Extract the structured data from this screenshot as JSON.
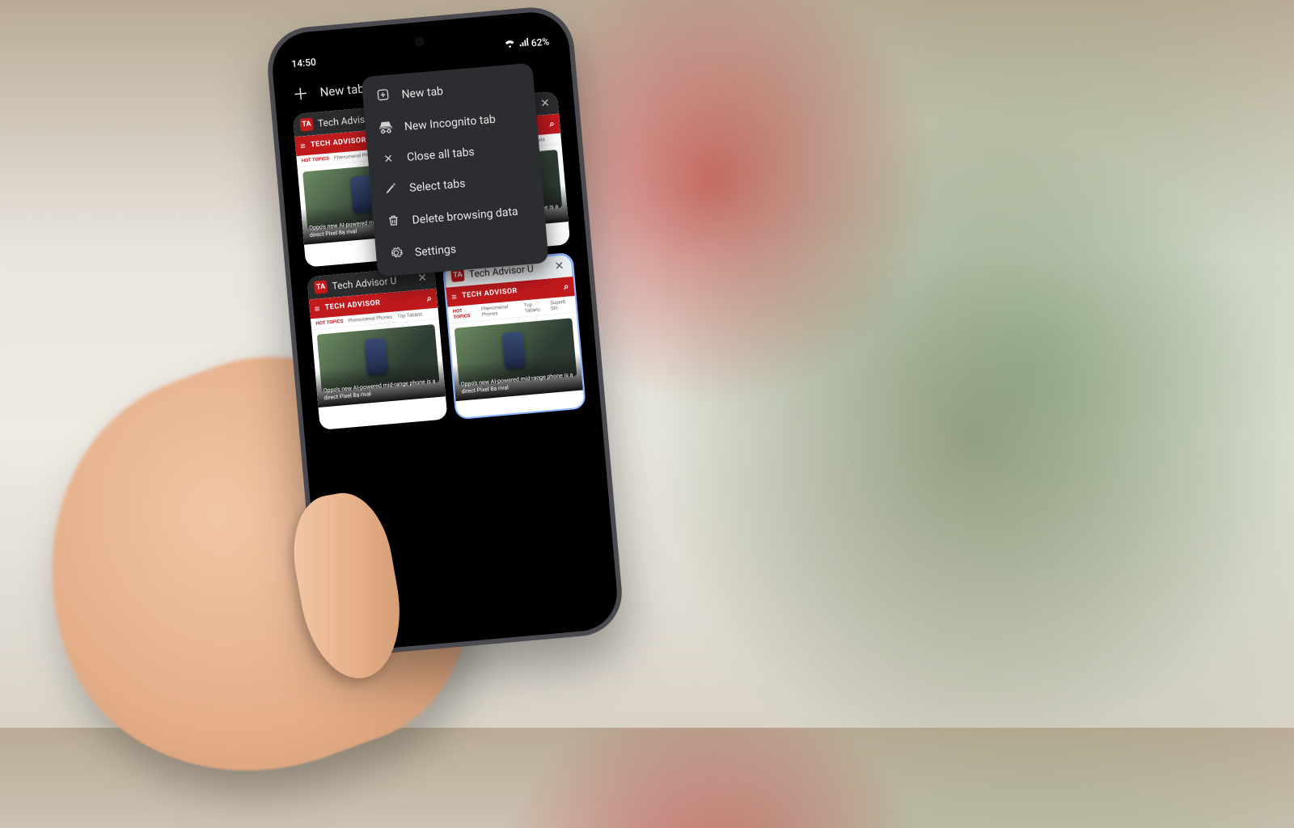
{
  "status": {
    "time": "14:50",
    "battery": "62%"
  },
  "topbar": {
    "new_tab_label": "New tab"
  },
  "menu": {
    "items": [
      {
        "icon": "plus-box-icon",
        "label": "New tab"
      },
      {
        "icon": "incognito-icon",
        "label": "New Incognito tab"
      },
      {
        "icon": "close-icon",
        "label": "Close all tabs"
      },
      {
        "icon": "pencil-icon",
        "label": "Select tabs"
      },
      {
        "icon": "trash-icon",
        "label": "Delete browsing data"
      },
      {
        "icon": "gear-icon",
        "label": "Settings"
      }
    ]
  },
  "tab_card": {
    "title": "Tech Advisor U",
    "favicon_text": "TA",
    "site_brand": "TECH ADVISOR",
    "tag_hot": "HOT TOPICS",
    "tag1": "Phenomenal Phones",
    "tag2": "Top Tablets",
    "tag3": "Superb Sm",
    "headline": "Oppo's new AI-powered mid-range phone is a direct Pixel 8a rival"
  },
  "tabs": [
    {
      "selected": false
    },
    {
      "selected": false
    },
    {
      "selected": false
    },
    {
      "selected": true
    }
  ]
}
